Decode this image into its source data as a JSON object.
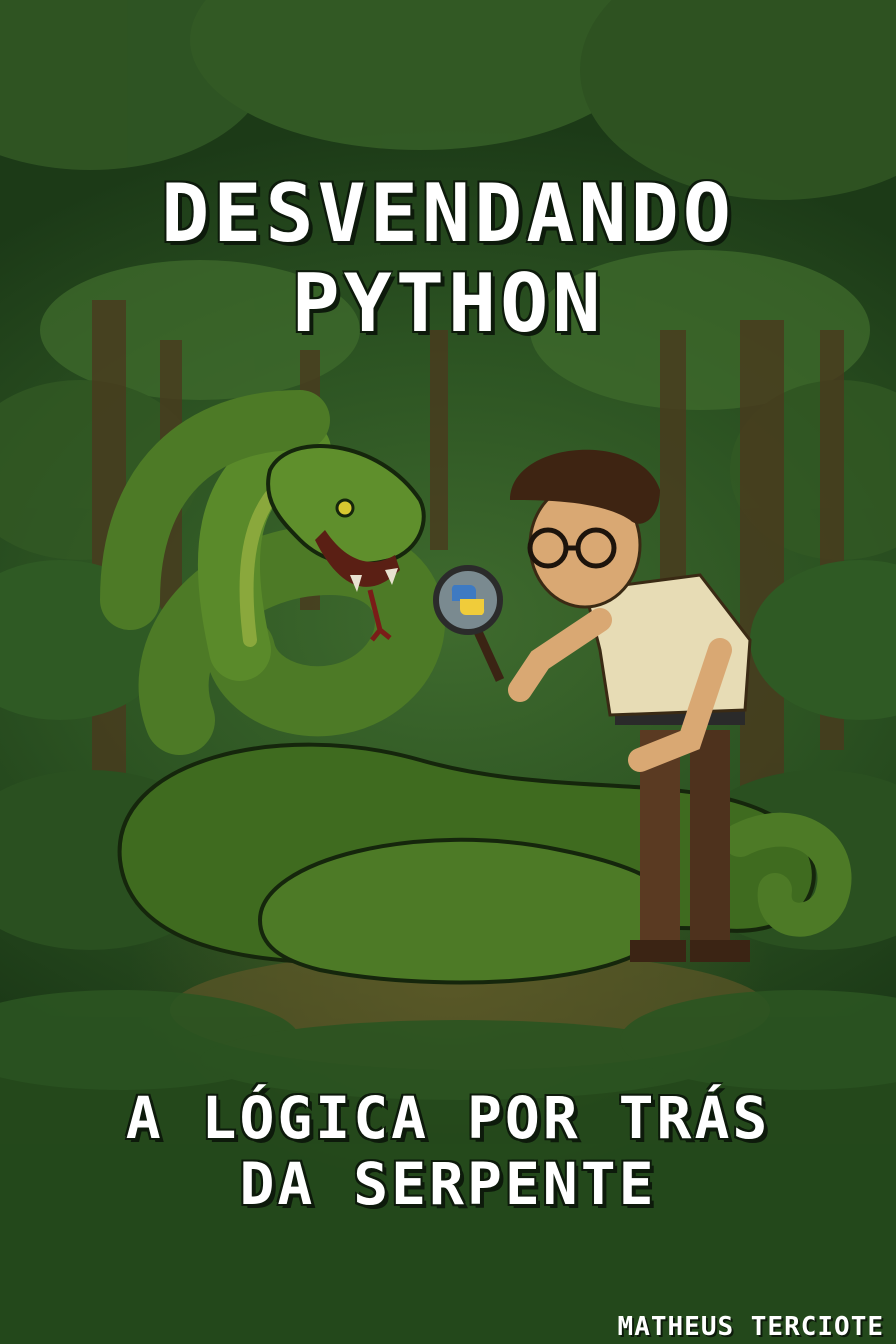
{
  "cover": {
    "title_line_1": "DESVENDANDO",
    "title_line_2": "PYTHON",
    "subtitle_line_1": "A LÓGICA POR TRÁS",
    "subtitle_line_2": "DA SERPENTE",
    "author": "MATHEUS TERCIOTE"
  },
  "colors": {
    "background": "#2c5322",
    "snake": "#4d7a26",
    "snake_light": "#8aa83c",
    "text": "#ffffff",
    "shirt": "#e7dcb5",
    "pants": "#5a3a22"
  },
  "icons": [
    "python-logo-icon",
    "magnifying-glass-icon"
  ]
}
